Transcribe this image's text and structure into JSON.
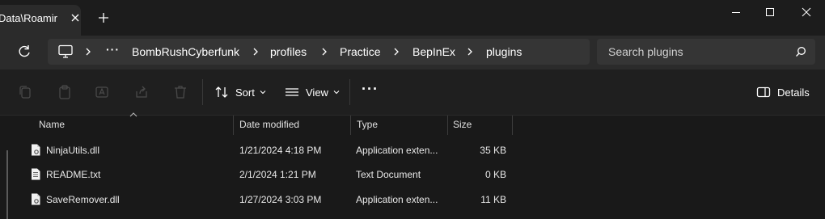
{
  "tab": {
    "title": "Data\\Roamir"
  },
  "address": {
    "overflow": "···",
    "crumbs": [
      "BombRushCyberfunk",
      "profiles",
      "Practice",
      "BepInEx",
      "plugins"
    ]
  },
  "search": {
    "placeholder": "Search plugins"
  },
  "toolbar": {
    "sort": "Sort",
    "view": "View",
    "more": "···",
    "details": "Details"
  },
  "columns": {
    "name": "Name",
    "date": "Date modified",
    "type": "Type",
    "size": "Size"
  },
  "files": [
    {
      "name": "NinjaUtils.dll",
      "date": "1/21/2024 4:18 PM",
      "type": "Application exten...",
      "size": "35 KB",
      "icon": "dll-file-icon"
    },
    {
      "name": "README.txt",
      "date": "2/1/2024 1:21 PM",
      "type": "Text Document",
      "size": "0 KB",
      "icon": "text-file-icon"
    },
    {
      "name": "SaveRemover.dll",
      "date": "1/27/2024 3:03 PM",
      "type": "Application exten...",
      "size": "11 KB",
      "icon": "dll-file-icon"
    }
  ]
}
